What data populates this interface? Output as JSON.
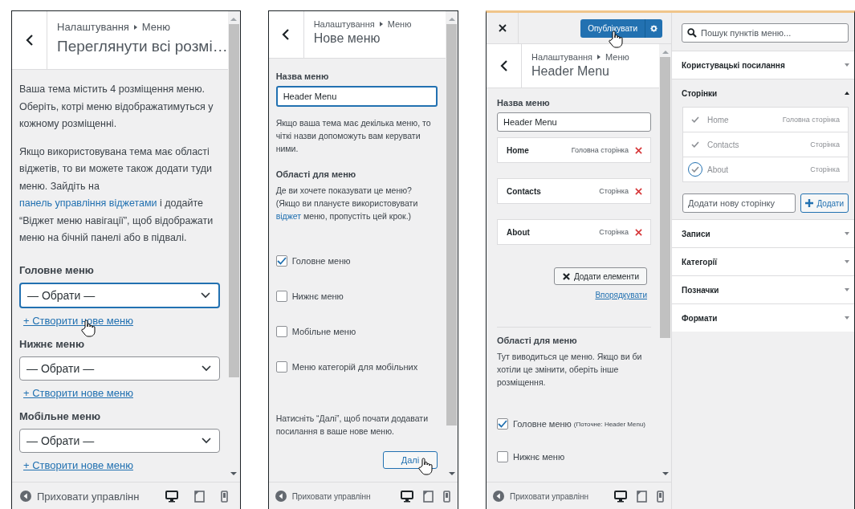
{
  "panels": [
    {
      "kind": "locations",
      "breadcrumb": [
        "Налаштування",
        "Меню"
      ],
      "title": "Переглянути всі розмі…",
      "intro": "Ваша тема містить 4 розміщення меню. Оберіть, котрі меню відображатимуться у кожному розміщенні.",
      "widgets_note": [
        {
          "text": "Якщо використовувана тема має області віджетів, то ви можете також додати туди меню. Зайдіть на ",
          "kind": "text"
        },
        {
          "text": "панель управління віджетами",
          "kind": "link"
        },
        {
          "text": " і додайте “Віджет меню навігації”, щоб відображати меню на бічній панелі або в підвалі.",
          "kind": "text"
        }
      ],
      "locations": [
        {
          "label": "Головне меню",
          "select": "— Обрати —",
          "focused": true,
          "create_link": "+ Створити нове меню",
          "hovered": true
        },
        {
          "label": "Нижнє меню",
          "select": "— Обрати —",
          "focused": false,
          "create_link": "+ Створити нове меню",
          "hovered": false
        },
        {
          "label": "Мобільне меню",
          "select": "— Обрати —",
          "focused": false,
          "create_link": "+ Створити нове меню",
          "hovered": false
        }
      ],
      "footer": {
        "label": "Приховати управлінн",
        "devices": [
          {
            "kind": "desktop",
            "selected": true
          },
          {
            "kind": "tablet",
            "selected": false
          },
          {
            "kind": "mobile",
            "selected": false
          }
        ]
      }
    },
    {
      "kind": "new_menu",
      "breadcrumb": [
        "Налаштування",
        "Меню"
      ],
      "title": "Нове меню",
      "name_label": "Назва меню",
      "name_value": "Header Menu",
      "name_help": "Якщо ваша тема має декілька меню, то чіткі назви допоможуть вам керувати ними.",
      "areas_heading": "Області для меню",
      "areas_note": [
        {
          "text": "Де ви хочете показувати це меню? (Якщо ви плануєте використовувати ",
          "kind": "text"
        },
        {
          "text": "віджет",
          "kind": "link"
        },
        {
          "text": " меню, пропустіть цей крок.)",
          "kind": "text"
        }
      ],
      "areas": [
        {
          "label": "Головне меню",
          "checked": true
        },
        {
          "label": "Нижнє меню",
          "checked": false
        },
        {
          "label": "Мобільне меню",
          "checked": false
        },
        {
          "label": "Меню категорій для мобільних",
          "checked": false
        }
      ],
      "next_note": "Натисніть “Далі”, щоб почати додавати посилання в ваше нове меню.",
      "next_button": {
        "label": "Далі",
        "hovered": true
      },
      "footer": {
        "label": "Приховати управлінн",
        "devices": [
          {
            "kind": "desktop",
            "selected": true
          },
          {
            "kind": "tablet",
            "selected": false
          },
          {
            "kind": "mobile",
            "selected": false
          }
        ]
      }
    },
    {
      "kind": "edit_menu",
      "publish": {
        "label": "Опублікувати",
        "hovered": true
      },
      "breadcrumb": [
        "Налаштування",
        "Меню"
      ],
      "title": "Header Menu",
      "name_label": "Назва меню",
      "name_value": "Header Menu",
      "items": [
        {
          "title": "Home",
          "type": "Головна сторінка"
        },
        {
          "title": "Contacts",
          "type": "Сторінка"
        },
        {
          "title": "About",
          "type": "Сторінка"
        }
      ],
      "add_button": "Додати елементи",
      "reorder_link": "Впорядкувати",
      "areas_heading": "Області для меню",
      "areas_note": "Тут виводиться це меню. Якщо ви би хотіли це змінити, оберіть інше розміщення.",
      "areas": [
        {
          "label": "Головне меню",
          "note": "(Поточне: Header Menu)",
          "checked": true
        },
        {
          "label": "Нижнє меню",
          "checked": false
        }
      ],
      "footer": {
        "label": "Приховати управлінн",
        "devices": [
          {
            "kind": "desktop",
            "selected": true
          },
          {
            "kind": "tablet",
            "selected": false
          },
          {
            "kind": "mobile",
            "selected": false
          }
        ]
      },
      "search_placeholder": "Пошук пунктів меню...",
      "sections": [
        {
          "title": "Користувацькі посилання",
          "expanded": false
        },
        {
          "title": "Сторінки",
          "expanded": true,
          "pages": [
            {
              "title": "Home",
              "type": "Головна сторінка",
              "selected": false
            },
            {
              "title": "Contacts",
              "type": "Сторінка",
              "selected": false
            },
            {
              "title": "About",
              "type": "Сторінка",
              "selected": true
            }
          ],
          "new_page_placeholder": "Додати нову сторінку",
          "add_label": "Додати"
        },
        {
          "title": "Записи",
          "expanded": false
        },
        {
          "title": "Категорії",
          "expanded": false
        },
        {
          "title": "Позначки",
          "expanded": false
        },
        {
          "title": "Формати",
          "expanded": false
        }
      ]
    }
  ]
}
